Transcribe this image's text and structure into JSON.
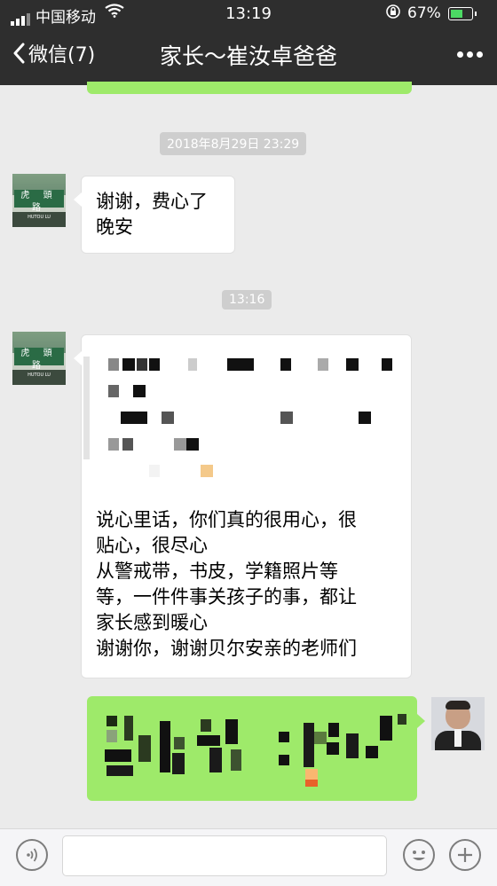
{
  "status_bar": {
    "carrier": "中国移动",
    "time": "13:19",
    "battery_percent": "67%",
    "battery_level": 0.67,
    "icons": [
      "signal-icon",
      "wifi-icon",
      "orientation-lock-icon",
      "battery-icon"
    ]
  },
  "nav": {
    "back_label": "微信(7)",
    "title": "家长～崔汝卓爸爸",
    "icons": [
      "back-chevron-icon",
      "more-icon"
    ]
  },
  "chat": {
    "timestamp_1": "2018年8月29日 23:29",
    "message_1": {
      "sender": "other",
      "lines": [
        "谢谢，费心了",
        "晚安"
      ]
    },
    "timestamp_2": "13:16",
    "message_2": {
      "sender": "other",
      "lines": [
        "说心里话，你们真的很用心，很",
        "贴心，很尽心",
        "从警戒带，书皮，学籍照片等",
        "等，一件件事关孩子的事，都让",
        "家长感到暖心",
        "谢谢你，谢谢贝尔安亲的老师们"
      ],
      "redacted_header": true
    },
    "message_3": {
      "sender": "self",
      "redacted": true
    },
    "avatar_sign_text": "虎 頭 路",
    "avatar_sign_subtext": "HUTOU LU"
  },
  "input_bar": {
    "icons": [
      "voice-icon",
      "emoji-icon",
      "plus-icon"
    ]
  },
  "colors": {
    "header_bg": "#2e2e2e",
    "chat_bg": "#ebebeb",
    "self_bubble": "#9eea6a",
    "other_bubble": "#ffffff",
    "timestamp_bg": "#cecece"
  }
}
